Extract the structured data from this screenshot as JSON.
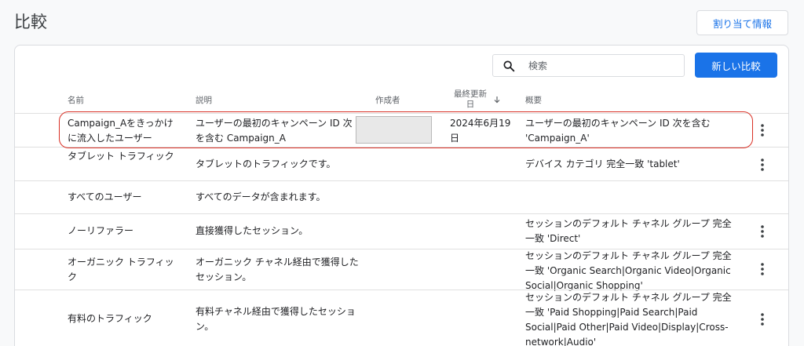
{
  "page": {
    "title": "比較",
    "assign_label": "割り当て情報"
  },
  "toolbar": {
    "search_placeholder": "検索",
    "new_label": "新しい比較"
  },
  "columns": {
    "name": "名前",
    "description": "説明",
    "creator": "作成者",
    "updated": "最終更新日",
    "summary": "概要"
  },
  "rows": [
    {
      "name": "Campaign_Aをきっかけに流入したユーザー",
      "description": "ユーザーの最初のキャンペーン ID 次を含む Campaign_A",
      "date": "2024年6月19日",
      "summary": "ユーザーの最初のキャンペーン ID 次を含む 'Campaign_A'"
    },
    {
      "name": "タブレット トラフィック",
      "description": "タブレットのトラフィックです。",
      "date": "",
      "summary": "デバイス カテゴリ 完全一致 'tablet'"
    },
    {
      "name": "すべてのユーザー",
      "description": "すべてのデータが含まれます。",
      "date": "",
      "summary": ""
    },
    {
      "name": "ノーリファラー",
      "description": "直接獲得したセッション。",
      "date": "",
      "summary": "セッションのデフォルト チャネル グループ 完全一致 'Direct'"
    },
    {
      "name": "オーガニック トラフィック",
      "description": "オーガニック チャネル経由で獲得したセッション。",
      "date": "",
      "summary": "セッションのデフォルト チャネル グループ 完全一致 'Organic Search|Organic Video|Organic Social|Organic Shopping'"
    },
    {
      "name": "有料のトラフィック",
      "description": "有料チャネル経由で獲得したセッション。",
      "date": "",
      "summary": "セッションのデフォルト チャネル グループ 完全一致 'Paid Shopping|Paid Search|Paid Social|Paid Other|Paid Video|Display|Cross-network|Audio'"
    }
  ],
  "colors": {
    "primary": "#1a73e8",
    "highlight": "#d93025",
    "border": "#dadce0"
  }
}
